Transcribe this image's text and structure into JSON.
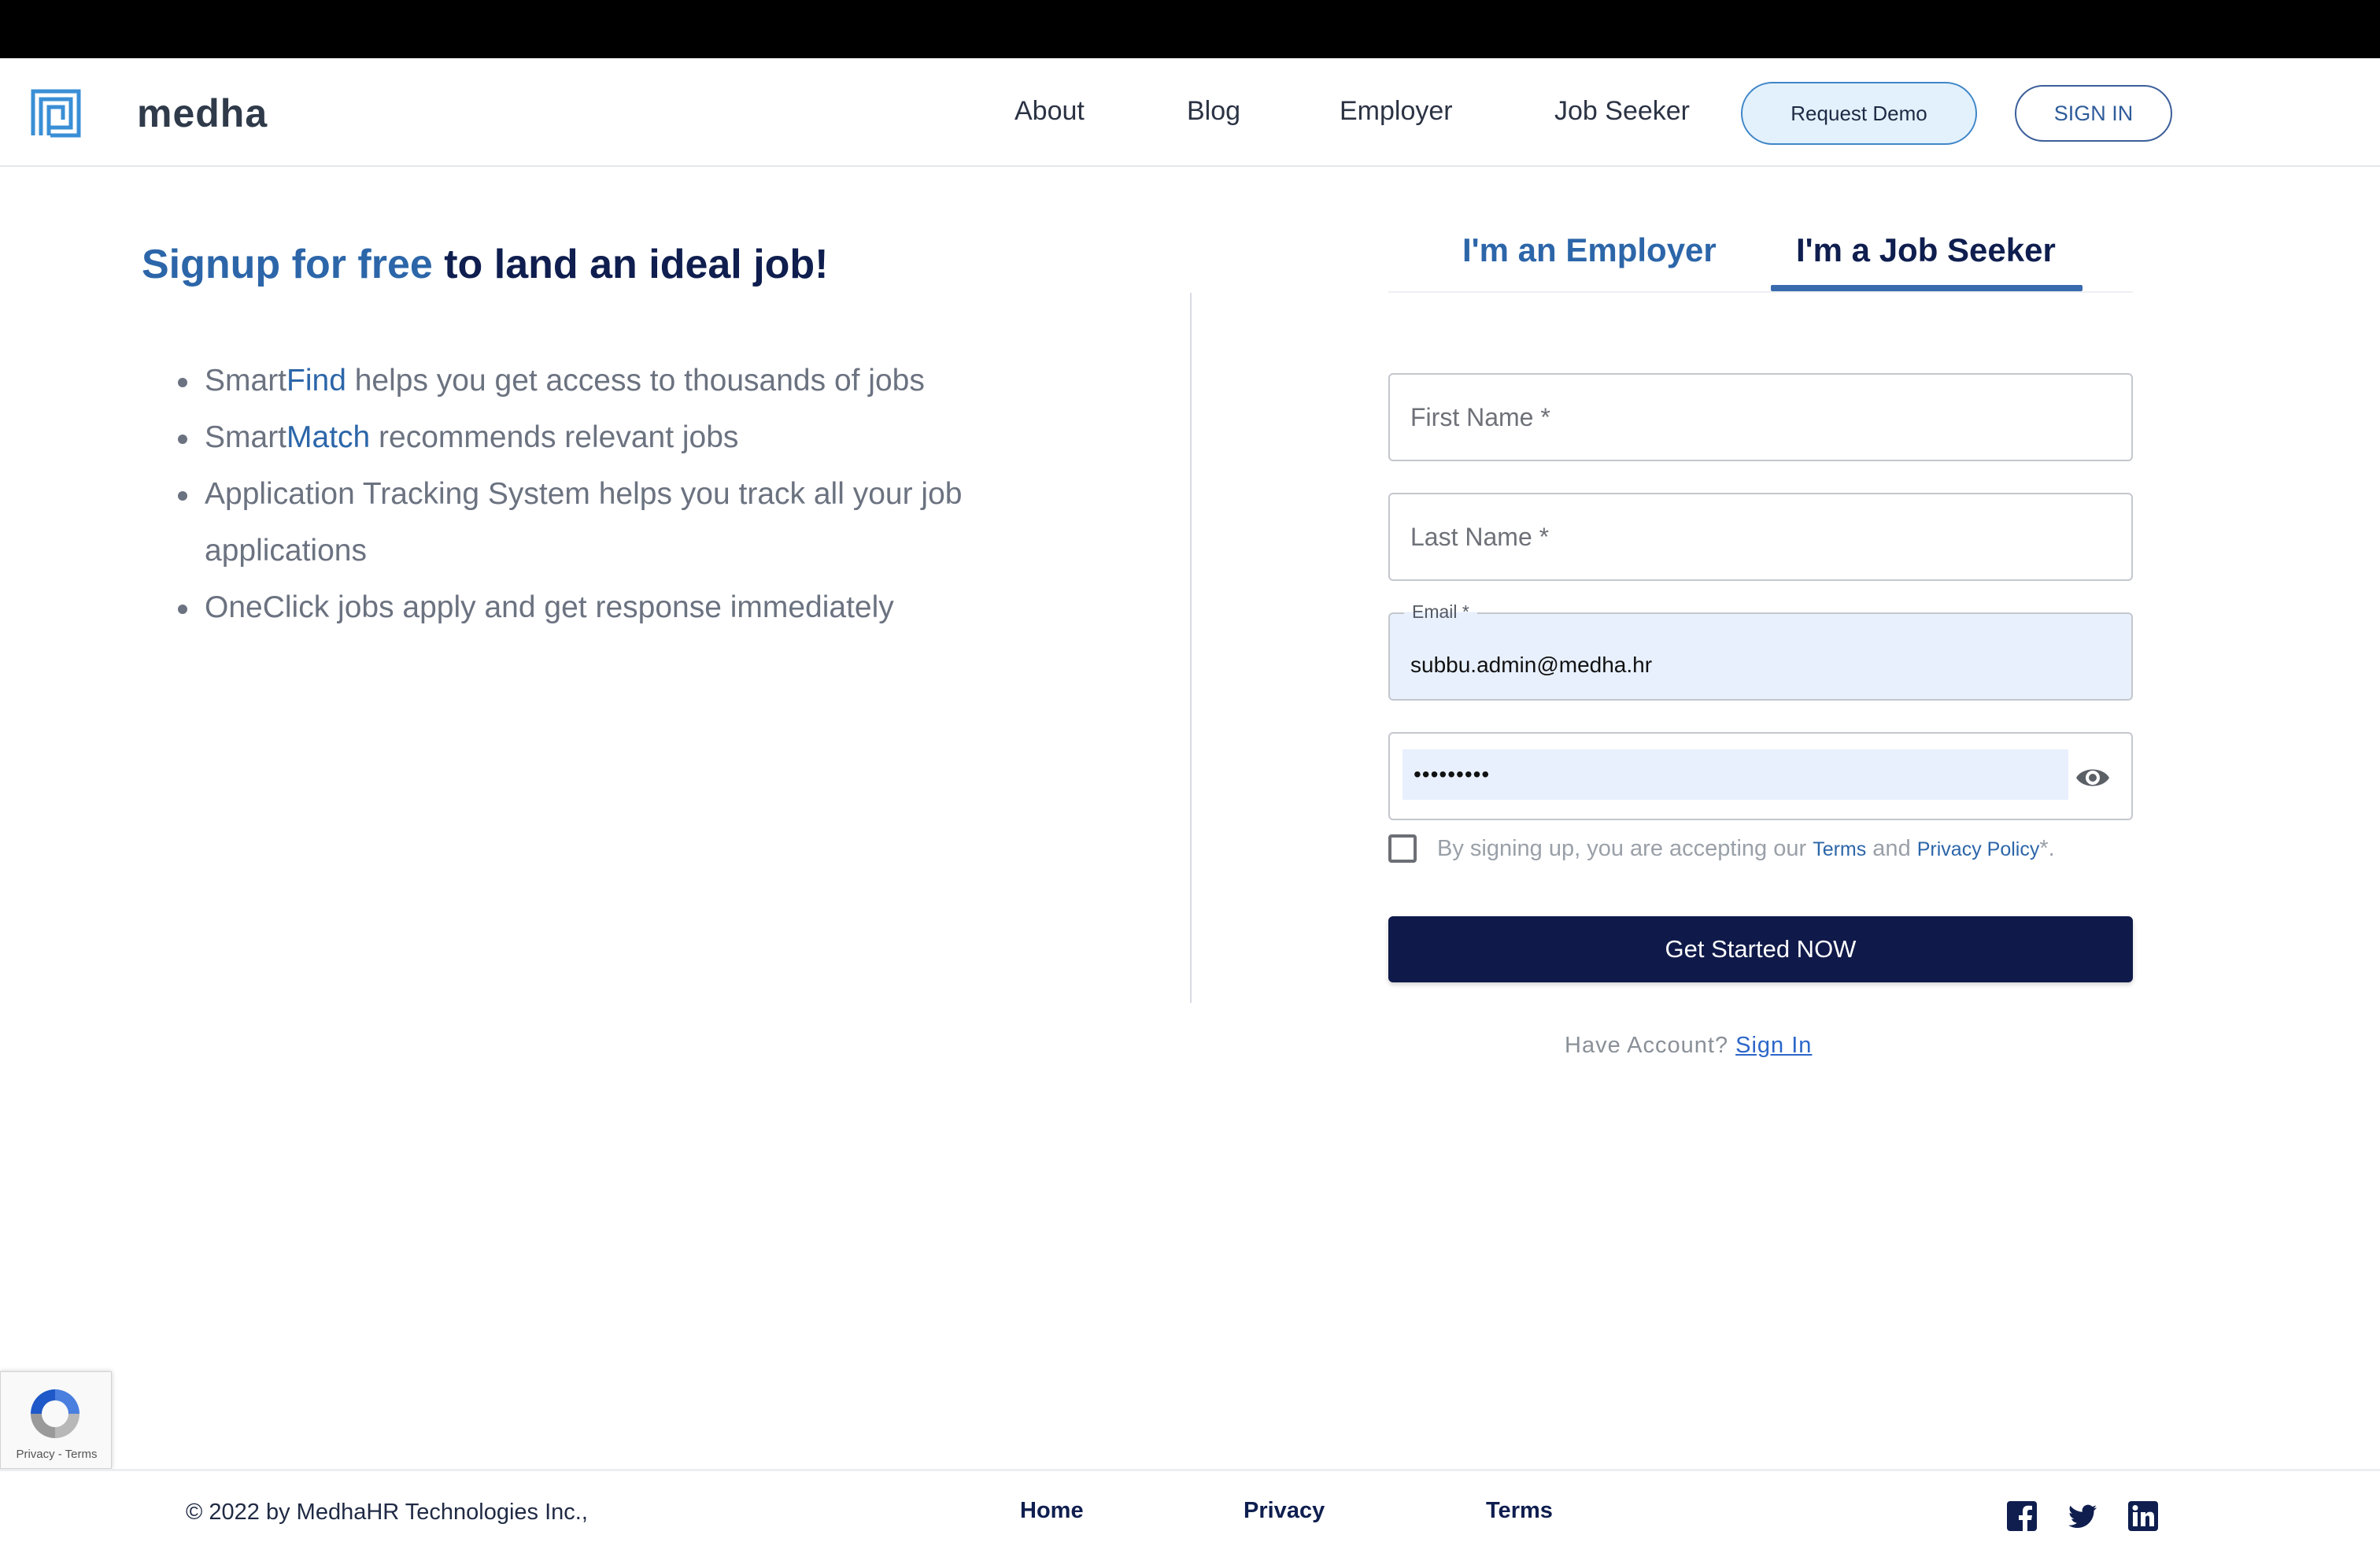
{
  "brand": {
    "name": "medha",
    "accent_color": "#2c66a9",
    "dark_navy": "#0f1a4a"
  },
  "nav": {
    "links": [
      "About",
      "Blog",
      "Employer",
      "Job Seeker"
    ],
    "request_demo": "Request Demo",
    "sign_in": "SIGN IN"
  },
  "hero": {
    "headline_highlight": "Signup for free",
    "headline_rest": " to land an ideal job!",
    "features": [
      {
        "prefix": "Smart",
        "accent": "Find",
        "rest": " helps you get access to thousands of jobs"
      },
      {
        "prefix": "Smart",
        "accent": "Match",
        "rest": " recommends relevant jobs"
      },
      {
        "prefix": "Application Tracking System helps you track all your job applications",
        "accent": "",
        "rest": ""
      },
      {
        "prefix": "OneClick jobs apply and get response immediately",
        "accent": "",
        "rest": ""
      }
    ]
  },
  "tabs": {
    "employer": "I'm an Employer",
    "seeker": "I'm a Job Seeker",
    "active": "seeker"
  },
  "form": {
    "first_name_placeholder": "First Name *",
    "last_name_placeholder": "Last Name *",
    "email_label": "Email *",
    "email_value": "subbu.admin@medha.hr",
    "password_value": "•••••••••",
    "consent_prefix": "By signing up, you are accepting our ",
    "terms_link": "Terms",
    "consent_and": " and ",
    "privacy_link": "Privacy Policy",
    "consent_suffix": "*.",
    "submit": "Get Started NOW",
    "have_account": "Have Account? ",
    "sign_in_link": "Sign In"
  },
  "recaptcha": {
    "links": "Privacy - Terms"
  },
  "footer": {
    "copyright": "© 2022 by MedhaHR Technologies Inc.,",
    "links": [
      "Home",
      "Privacy",
      "Terms"
    ],
    "social_icons": [
      "facebook-icon",
      "twitter-icon",
      "linkedin-icon"
    ]
  }
}
